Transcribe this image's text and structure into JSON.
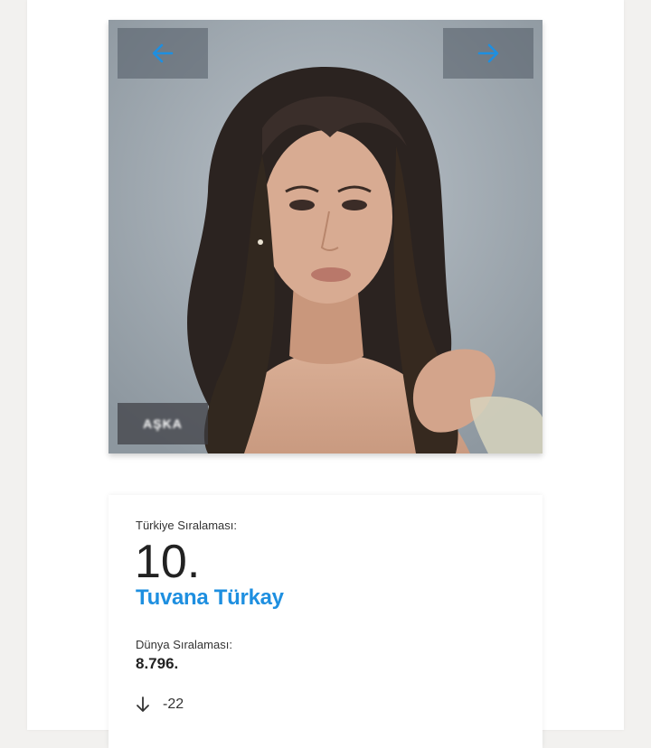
{
  "carousel": {
    "caption": "AŞKA",
    "prev_icon": "arrow-left-icon",
    "next_icon": "arrow-right-icon"
  },
  "ranking": {
    "turkey_label": "Türkiye Sıralaması:",
    "turkey_rank": "10.",
    "name": "Tuvana Türkay",
    "world_label": "Dünya Sıralaması:",
    "world_rank": "8.796.",
    "change_icon": "arrow-down-icon",
    "change": "-22"
  },
  "colors": {
    "accent": "#1e8fe0",
    "page_background": "#f2f1ef"
  }
}
